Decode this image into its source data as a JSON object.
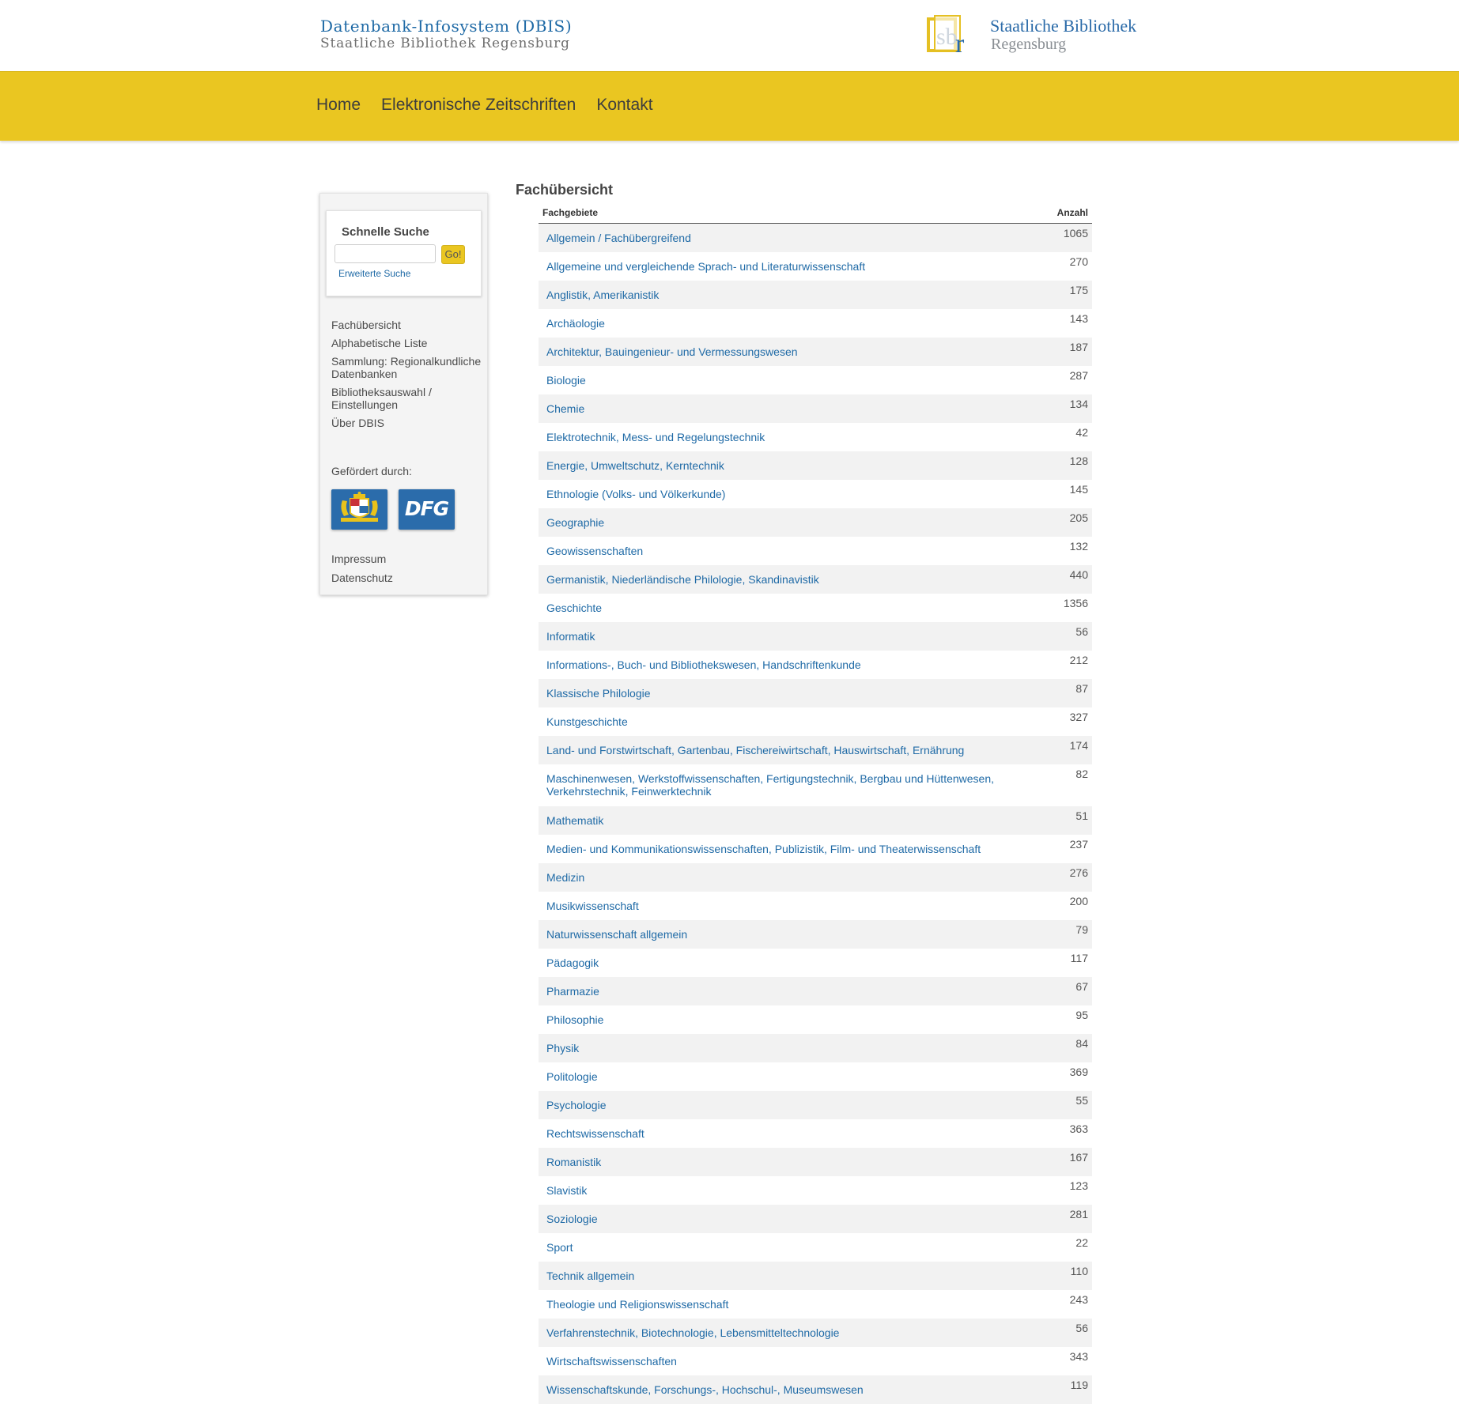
{
  "header": {
    "site_title": "Datenbank-Infosystem (DBIS)",
    "site_subtitle": "Staatliche Bibliothek Regensburg",
    "logo": {
      "icon": "sbr-logo-icon",
      "line1": "Staatliche Bibliothek",
      "line2": "Regensburg"
    }
  },
  "nav": {
    "items": [
      {
        "label": "Home"
      },
      {
        "label": "Elektronische Zeitschriften"
      },
      {
        "label": "Kontakt"
      }
    ]
  },
  "sidebar": {
    "search": {
      "title": "Schnelle Suche",
      "input_value": "",
      "go_label": "Go!",
      "advanced_link": "Erweiterte Suche"
    },
    "links": [
      {
        "label": "Fachübersicht"
      },
      {
        "label": "Alphabetische Liste"
      },
      {
        "label": "Sammlung: Regionalkundliche Datenbanken"
      },
      {
        "label": "Bibliotheksauswahl / Einstellungen"
      },
      {
        "label": "Über DBIS"
      }
    ],
    "funded_label": "Gefördert durch:",
    "sponsors": [
      {
        "icon": "bavarian-coat-of-arms-icon"
      },
      {
        "icon": "dfg-logo-icon",
        "text": "DFG"
      }
    ],
    "footer_links": [
      {
        "label": "Impressum"
      },
      {
        "label": "Datenschutz"
      }
    ]
  },
  "main": {
    "heading": "Fachübersicht",
    "table": {
      "col_subject": "Fachgebiete",
      "col_count": "Anzahl",
      "rows": [
        {
          "subject": "Allgemein / Fachübergreifend",
          "count": "1065"
        },
        {
          "subject": "Allgemeine und vergleichende Sprach- und Literaturwissenschaft",
          "count": "270"
        },
        {
          "subject": "Anglistik, Amerikanistik",
          "count": "175"
        },
        {
          "subject": "Archäologie",
          "count": "143"
        },
        {
          "subject": "Architektur, Bauingenieur- und Vermessungswesen",
          "count": "187"
        },
        {
          "subject": "Biologie",
          "count": "287"
        },
        {
          "subject": "Chemie",
          "count": "134"
        },
        {
          "subject": "Elektrotechnik, Mess- und Regelungstechnik",
          "count": "42"
        },
        {
          "subject": "Energie, Umweltschutz, Kerntechnik",
          "count": "128"
        },
        {
          "subject": "Ethnologie (Volks- und Völkerkunde)",
          "count": "145"
        },
        {
          "subject": "Geographie",
          "count": "205"
        },
        {
          "subject": "Geowissenschaften",
          "count": "132"
        },
        {
          "subject": "Germanistik, Niederländische Philologie, Skandinavistik",
          "count": "440"
        },
        {
          "subject": "Geschichte",
          "count": "1356"
        },
        {
          "subject": "Informatik",
          "count": "56"
        },
        {
          "subject": "Informations-, Buch- und Bibliothekswesen, Handschriftenkunde",
          "count": "212"
        },
        {
          "subject": "Klassische Philologie",
          "count": "87"
        },
        {
          "subject": "Kunstgeschichte",
          "count": "327"
        },
        {
          "subject": "Land- und Forstwirtschaft, Gartenbau, Fischereiwirtschaft, Hauswirtschaft, Ernährung",
          "count": "174"
        },
        {
          "subject": "Maschinenwesen, Werkstoffwissenschaften, Fertigungstechnik, Bergbau und Hüttenwesen, Verkehrstechnik, Feinwerktechnik",
          "count": "82"
        },
        {
          "subject": "Mathematik",
          "count": "51"
        },
        {
          "subject": "Medien- und Kommunikationswissenschaften, Publizistik, Film- und Theaterwissenschaft",
          "count": "237"
        },
        {
          "subject": "Medizin",
          "count": "276"
        },
        {
          "subject": "Musikwissenschaft",
          "count": "200"
        },
        {
          "subject": "Naturwissenschaft allgemein",
          "count": "79"
        },
        {
          "subject": "Pädagogik",
          "count": "117"
        },
        {
          "subject": "Pharmazie",
          "count": "67"
        },
        {
          "subject": "Philosophie",
          "count": "95"
        },
        {
          "subject": "Physik",
          "count": "84"
        },
        {
          "subject": "Politologie",
          "count": "369"
        },
        {
          "subject": "Psychologie",
          "count": "55"
        },
        {
          "subject": "Rechtswissenschaft",
          "count": "363"
        },
        {
          "subject": "Romanistik",
          "count": "167"
        },
        {
          "subject": "Slavistik",
          "count": "123"
        },
        {
          "subject": "Soziologie",
          "count": "281"
        },
        {
          "subject": "Sport",
          "count": "22"
        },
        {
          "subject": "Technik allgemein",
          "count": "110"
        },
        {
          "subject": "Theologie und Religionswissenschaft",
          "count": "243"
        },
        {
          "subject": "Verfahrenstechnik, Biotechnologie, Lebensmitteltechnologie",
          "count": "56"
        },
        {
          "subject": "Wirtschaftswissenschaften",
          "count": "343"
        },
        {
          "subject": "Wissenschaftskunde, Forschungs-, Hochschul-, Museumswesen",
          "count": "119"
        }
      ]
    }
  },
  "colors": {
    "accent_yellow": "#eac621",
    "link_blue": "#1f6aa6",
    "sponsor_blue": "#2b6cab"
  }
}
